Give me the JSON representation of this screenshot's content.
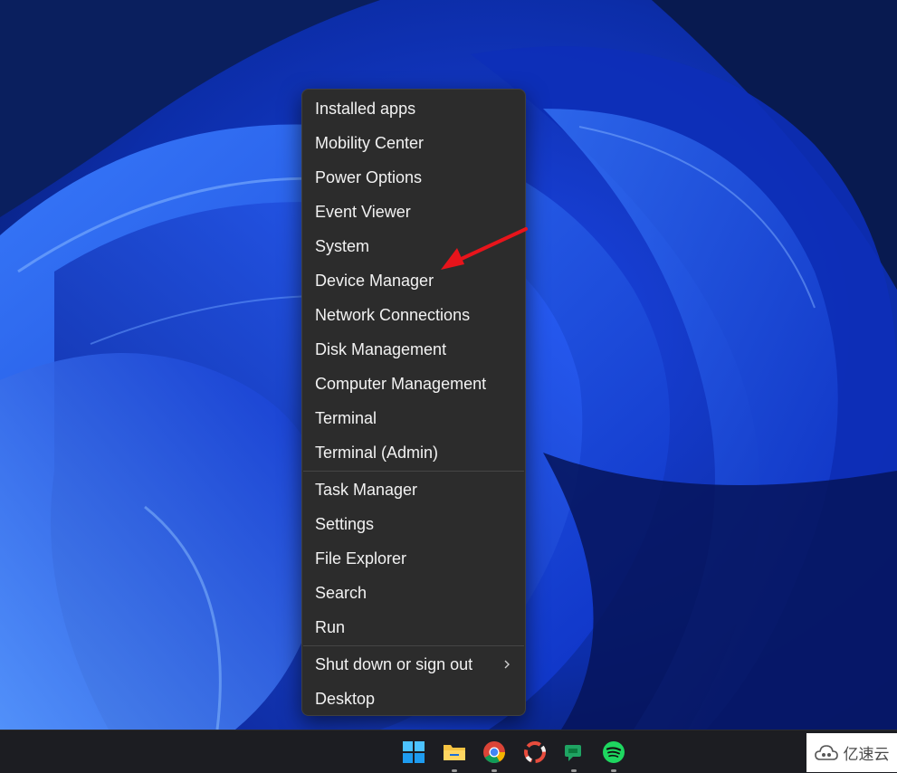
{
  "context_menu": {
    "group1": [
      "Installed apps",
      "Mobility Center",
      "Power Options",
      "Event Viewer",
      "System",
      "Device Manager",
      "Network Connections",
      "Disk Management",
      "Computer Management",
      "Terminal",
      "Terminal (Admin)"
    ],
    "group2": [
      "Task Manager",
      "Settings",
      "File Explorer",
      "Search",
      "Run"
    ],
    "group3": [
      "Shut down or sign out",
      "Desktop"
    ]
  },
  "annotation": {
    "arrow_target": "Device Manager",
    "arrow_color": "#e8141b"
  },
  "taskbar": {
    "icons": [
      "windows-start-icon",
      "file-explorer-icon",
      "chrome-icon",
      "photo-app-icon",
      "chat-app-icon",
      "spotify-icon"
    ]
  },
  "watermark": {
    "text": "亿速云"
  },
  "colors": {
    "menu_bg": "#2c2c2c",
    "menu_text": "#f2f2f2",
    "taskbar_bg": "#1c1d22"
  }
}
